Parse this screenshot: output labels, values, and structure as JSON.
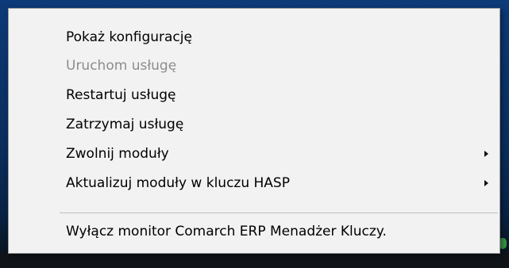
{
  "context_menu": {
    "items": [
      {
        "label": "Pokaż konfigurację",
        "enabled": true,
        "has_submenu": false
      },
      {
        "label": "Uruchom usługę",
        "enabled": false,
        "has_submenu": false
      },
      {
        "label": "Restartuj usługę",
        "enabled": true,
        "has_submenu": false
      },
      {
        "label": "Zatrzymaj usługę",
        "enabled": true,
        "has_submenu": false
      },
      {
        "label": "Zwolnij moduły",
        "enabled": true,
        "has_submenu": true
      },
      {
        "label": "Aktualizuj moduły w kluczu HASP",
        "enabled": true,
        "has_submenu": true
      }
    ],
    "footer_item": {
      "label": "Wyłącz monitor Comarch ERP Menadżer Kluczy.",
      "enabled": true
    },
    "submenu_arrow_icon": "chevron-right-icon"
  },
  "colors": {
    "menu_background": "#f2f2f2",
    "menu_border": "#9a9a9a",
    "text_enabled": "#000000",
    "text_disabled": "#8c8c8c",
    "desktop_background": "#0d3a78"
  }
}
